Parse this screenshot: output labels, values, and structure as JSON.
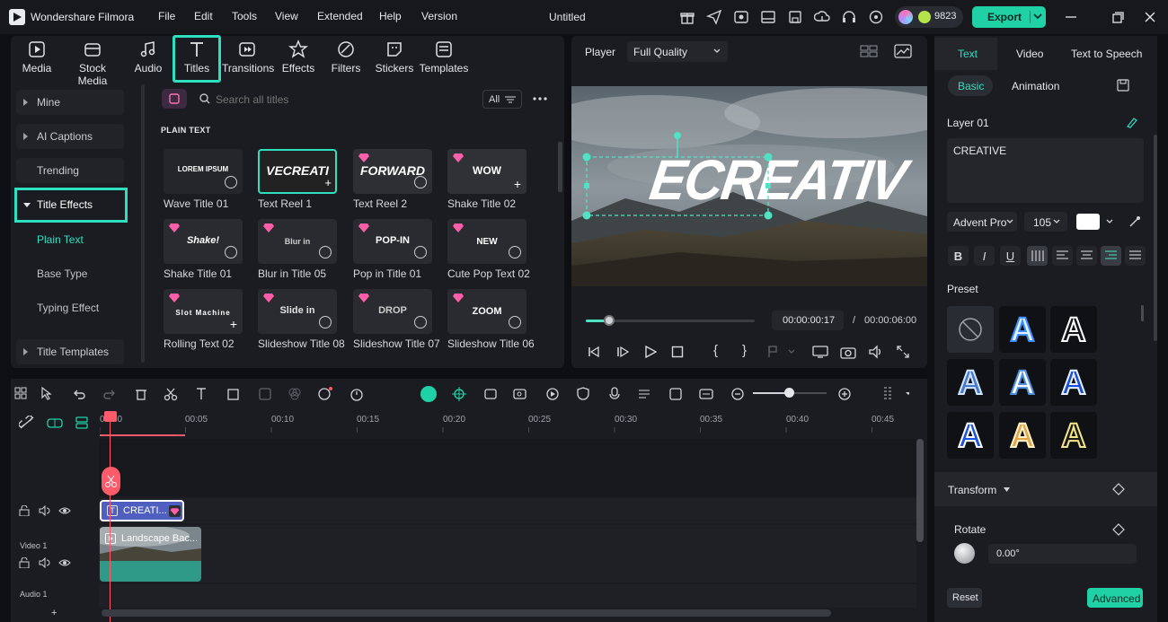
{
  "app": {
    "name": "Wondershare Filmora",
    "menu": [
      "File",
      "Edit",
      "Tools",
      "View",
      "Extended",
      "Help",
      "Version"
    ],
    "document_title": "Untitled",
    "credits": "9823",
    "export_label": "Export"
  },
  "library": {
    "tabs": [
      "Media",
      "Stock Media",
      "Audio",
      "Titles",
      "Transitions",
      "Effects",
      "Filters",
      "Stickers",
      "Templates"
    ],
    "active_tab": "Titles",
    "sidebar": {
      "mine": "Mine",
      "ai_captions": "AI Captions",
      "trending": "Trending",
      "title_effects": "Title Effects",
      "sub": [
        "Plain Text",
        "Base Type",
        "Typing Effect"
      ],
      "title_templates": "Title Templates"
    },
    "search_placeholder": "Search all titles",
    "filter_label": "All",
    "section_label": "PLAIN TEXT",
    "titles": [
      {
        "name": "Wave Title 01",
        "thumb": "LOREM IPSUM"
      },
      {
        "name": "Text Reel 1",
        "thumb": "VECREATI"
      },
      {
        "name": "Text Reel 2",
        "thumb": "FORWARD"
      },
      {
        "name": "Shake Title 02",
        "thumb": "WOW"
      },
      {
        "name": "Shake Title 01",
        "thumb": "Shake!"
      },
      {
        "name": "Blur in Title 05",
        "thumb": "Blur in"
      },
      {
        "name": "Pop in Title 01",
        "thumb": "POP-IN"
      },
      {
        "name": "Cute Pop Text 02",
        "thumb": "NEW"
      },
      {
        "name": "Rolling Text 02",
        "thumb": "Slot Machine"
      },
      {
        "name": "Slideshow Title 08",
        "thumb": "Slide in"
      },
      {
        "name": "Slideshow Title 07",
        "thumb": "DROP"
      },
      {
        "name": "Slideshow Title 06",
        "thumb": "ZOOM"
      }
    ]
  },
  "player": {
    "label": "Player",
    "quality": "Full Quality",
    "overlay_text": "ECREATIV",
    "current_time": "00:00:00:17",
    "separator": "/",
    "total_time": "00:00:06:00",
    "progress": 0.14
  },
  "properties": {
    "tabs": [
      "Text",
      "Video",
      "Text to Speech"
    ],
    "subtabs": [
      "Basic",
      "Animation"
    ],
    "layer": "Layer 01",
    "text_value": "CREATIVE",
    "font": "Advent Pro",
    "font_size": "105",
    "text_color": "#ffffff",
    "preset_label": "Preset",
    "transform_label": "Transform",
    "rotate_label": "Rotate",
    "rotate_value": "0.00°",
    "reset_label": "Reset",
    "advanced_label": "Advanced",
    "accent": "#1fd1a5"
  },
  "timeline": {
    "ruler": [
      "00:00",
      "00:05",
      "00:10",
      "00:15",
      "00:20",
      "00:25",
      "00:30",
      "00:35",
      "00:40",
      "00:45"
    ],
    "text_clip": "CREATI...",
    "video_track": "Video 1",
    "video_clip": "Landscape Bac...",
    "audio_track": "Audio 1",
    "zoom_level": 0.5
  }
}
